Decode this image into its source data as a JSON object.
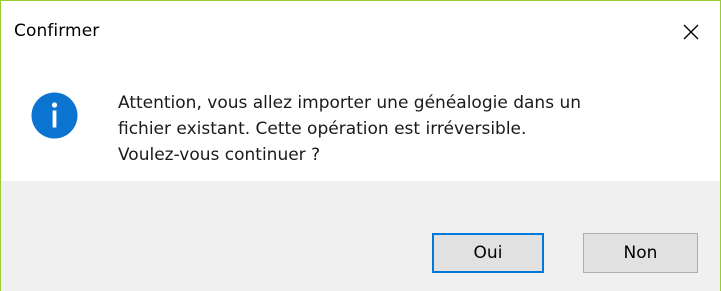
{
  "window": {
    "title": "Confirmer",
    "close_icon": "close-icon"
  },
  "message": {
    "icon": "info-icon",
    "lines": [
      "Attention, vous allez importer une généalogie dans un",
      "fichier existant. Cette opération est irréversible.",
      "Voulez-vous continuer ?"
    ]
  },
  "buttons": {
    "yes_label": "Oui",
    "no_label": "Non",
    "default_button": "Oui"
  },
  "colors": {
    "window_border": "#9acd32",
    "info_icon": "#0078d7",
    "footer_bg": "#f0f0f0",
    "focus_border": "#0078d7"
  }
}
